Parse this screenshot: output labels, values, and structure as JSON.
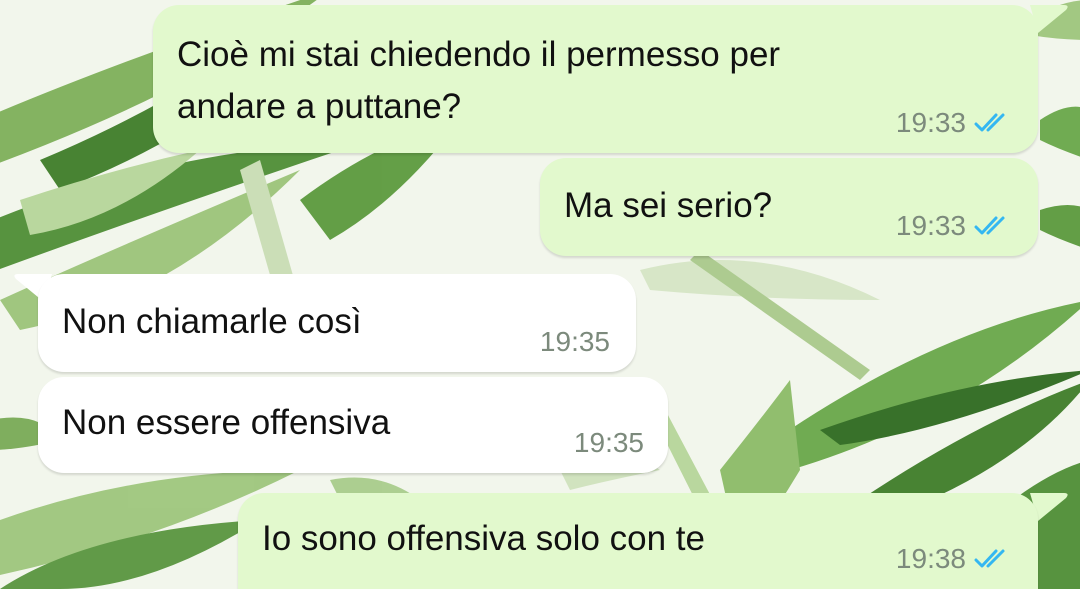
{
  "chat": {
    "messages": [
      {
        "direction": "outgoing",
        "lines": [
          "Cioè mi stai chiedendo il permesso per",
          "andare a puttane?"
        ],
        "time": "19:33",
        "status": "read"
      },
      {
        "direction": "outgoing",
        "lines": [
          "Ma sei serio?"
        ],
        "time": "19:33",
        "status": "read"
      },
      {
        "direction": "incoming",
        "lines": [
          "Non chiamarle così"
        ],
        "time": "19:35"
      },
      {
        "direction": "incoming",
        "lines": [
          "Non essere offensiva"
        ],
        "time": "19:35"
      },
      {
        "direction": "outgoing",
        "lines": [
          "Io sono offensiva solo con te"
        ],
        "time": "19:38",
        "status": "read"
      }
    ]
  },
  "colors": {
    "outgoing_bubble": "#e2f9cd",
    "incoming_bubble": "#ffffff",
    "read_tick": "#34b7f1",
    "meta_text": "#7c8a7c"
  },
  "icons": {
    "read_receipt": "double-check-icon"
  }
}
